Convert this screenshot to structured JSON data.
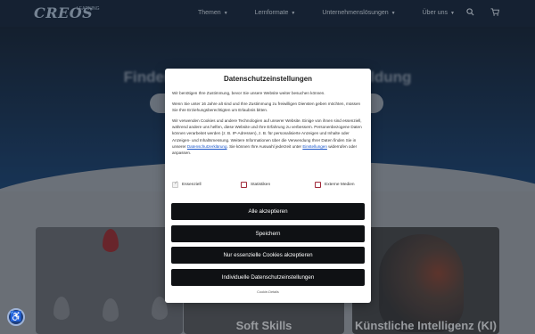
{
  "header": {
    "logo": "CREOS",
    "logo_sub": "LEARNING",
    "nav": [
      {
        "label": "Themen"
      },
      {
        "label": "Lernformate"
      },
      {
        "label": "Unternehmenslösungen"
      },
      {
        "label": "Über uns"
      }
    ],
    "icons": [
      "search-icon",
      "cart-icon"
    ]
  },
  "hero": {
    "title": "Finden Sie Ihre passende Weiterbildung"
  },
  "cards": [
    {
      "title": ""
    },
    {
      "title": "Soft Skills"
    },
    {
      "title": "Künstliche Intelligenz (KI)"
    }
  ],
  "consent": {
    "title": "Datenschutzeinstellungen",
    "p1": "Wir benötigen Ihre Zustimmung, bevor Sie unsere Website weiter besuchen können.",
    "p2": "Wenn Sie unter 16 Jahre alt sind und Ihre Zustimmung zu freiwilligen Diensten geben möchten, müssen Sie Ihre Erziehungsberechtigten um Erlaubnis bitten.",
    "p3_before": "Wir verwenden Cookies und andere Technologien auf unserer Website. Einige von ihnen sind essenziell, während andere uns helfen, diese Website und Ihre Erfahrung zu verbessern. Personenbezogene Daten können verarbeitet werden (z. B. IP-Adressen), z. B. für personalisierte Anzeigen und Inhalte oder Anzeigen- und Inhaltsmessung. Weitere Informationen über die Verwendung Ihrer Daten finden Sie in unserer ",
    "privacy_link": "Datenschutzerklärung",
    "p3_middle": ". Sie können Ihre Auswahl jederzeit unter ",
    "settings_link": "Einstellungen",
    "p3_after": " widerrufen oder anpassen.",
    "options": [
      {
        "label": "Essenziell",
        "checked": true
      },
      {
        "label": "Statistiken",
        "checked": false
      },
      {
        "label": "Externe Medien",
        "checked": false
      }
    ],
    "buttons": {
      "accept_all": "Alle akzeptieren",
      "save": "Speichern",
      "essential_only": "Nur essenzielle Cookies akzeptieren",
      "individual": "Individuelle Datenschutzeinstellungen"
    },
    "footer_link": "Cookie-Details"
  }
}
